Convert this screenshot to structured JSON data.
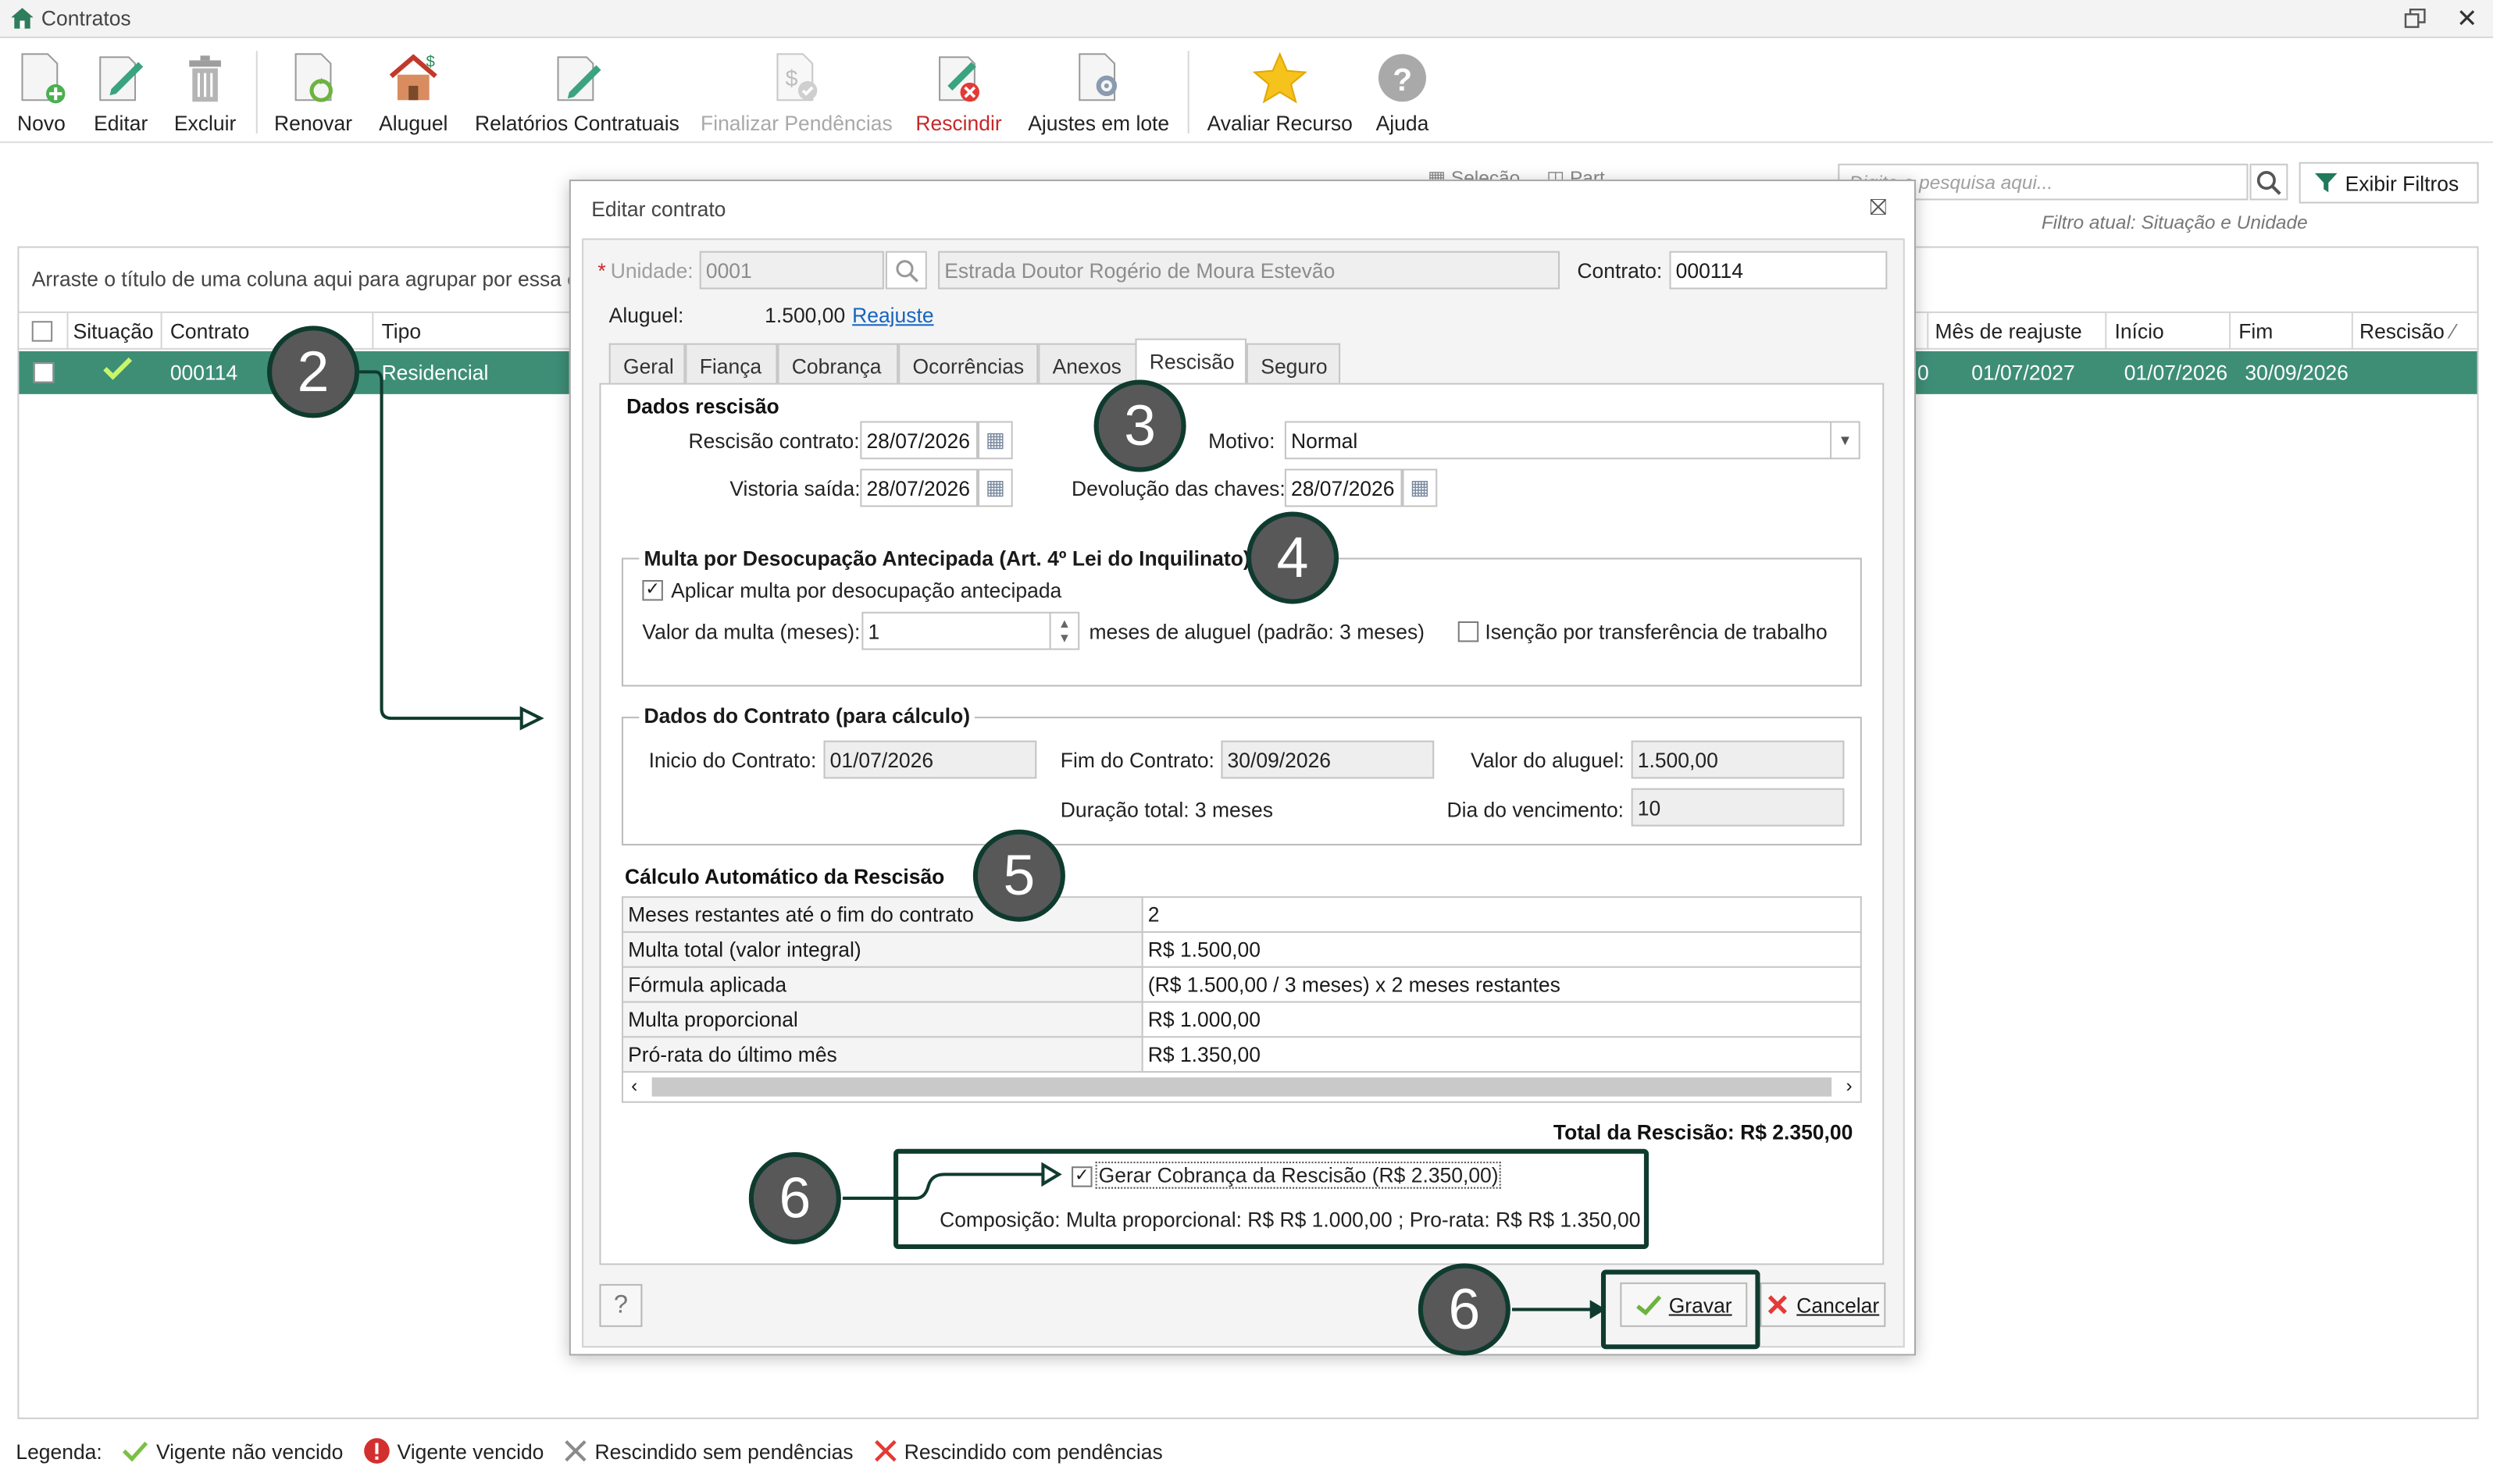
{
  "window": {
    "title": "Contratos"
  },
  "toolbar": {
    "novo": "Novo",
    "editar": "Editar",
    "excluir": "Excluir",
    "renovar": "Renovar",
    "aluguel": "Aluguel",
    "relatorios": "Relatórios Contratuais",
    "finalizar": "Finalizar Pendências",
    "rescindir": "Rescindir",
    "ajustes": "Ajustes em lote",
    "avaliar": "Avaliar Recurso",
    "ajuda": "Ajuda"
  },
  "search": {
    "placeholder": "Digite a pesquisa aqui...",
    "filter_button": "Exibir Filtros",
    "current_filter": "Filtro atual: Situação e Unidade"
  },
  "grid": {
    "group_hint": "Arraste o título de uma coluna aqui para agrupar por essa c",
    "columns": {
      "situacao": "Situação",
      "contrato": "Contrato",
      "tipo": "Tipo",
      "mes_reajuste": "Mês de reajuste",
      "inicio": "Início",
      "fim": "Fim",
      "rescisao": "Rescisão"
    },
    "row": {
      "contrato": "000114",
      "tipo": "Residencial",
      "cut_value": "0",
      "mes_reajuste": "01/07/2027",
      "inicio": "01/07/2026",
      "fim": "30/09/2026"
    }
  },
  "legend": {
    "label": "Legenda:",
    "vigente_nao_vencido": "Vigente não vencido",
    "vigente_vencido": "Vigente vencido",
    "rescindido_sem": "Rescindido sem pendências",
    "rescindido_com": "Rescindido com pendências"
  },
  "dialog": {
    "title": "Editar contrato",
    "unidade_label": "Unidade:",
    "unidade_required": "*",
    "unidade_code": "0001",
    "unidade_name": "Estrada Doutor Rogério de Moura Estevão",
    "contrato_label": "Contrato:",
    "contrato_value": "000114",
    "aluguel_label": "Aluguel:",
    "aluguel_value": "1.500,00",
    "reajuste_link": "Reajuste",
    "tabs": [
      "Geral",
      "Fiança",
      "Cobrança",
      "Ocorrências",
      "Anexos",
      "Rescisão",
      "Seguro"
    ],
    "dados_rescisao": {
      "title": "Dados rescisão",
      "rescisao_label": "Rescisão contrato:",
      "rescisao_value": "28/07/2026",
      "vistoria_label": "Vistoria saída:",
      "vistoria_value": "28/07/2026",
      "motivo_label": "Motivo:",
      "motivo_value": "Normal",
      "devolucao_label": "Devolução das chaves:",
      "devolucao_value": "28/07/2026"
    },
    "multa": {
      "title": "Multa por Desocupação Antecipada (Art. 4º Lei do Inquilinato)",
      "aplicar_label": "Aplicar multa por desocupação antecipada",
      "valor_label": "Valor da multa (meses):",
      "valor_value": "1",
      "meses_hint": "meses de aluguel (padrão: 3 meses)",
      "isencao_label": "Isenção por transferência de trabalho"
    },
    "dados_contrato": {
      "title": "Dados do Contrato (para cálculo)",
      "inicio_label": "Inicio do Contrato:",
      "inicio_value": "01/07/2026",
      "fim_label": "Fim do Contrato:",
      "fim_value": "30/09/2026",
      "valor_label": "Valor do aluguel:",
      "valor_value": "1.500,00",
      "duracao_text": "Duração total: 3 meses",
      "dia_label": "Dia do vencimento:",
      "dia_value": "10"
    },
    "calculo": {
      "title": "Cálculo Automático da Rescisão",
      "rows": [
        {
          "k": "Meses restantes até o fim do contrato",
          "v": "2"
        },
        {
          "k": "Multa total (valor integral)",
          "v": "R$ 1.500,00"
        },
        {
          "k": "Fórmula aplicada",
          "v": "(R$ 1.500,00 / 3 meses) x 2 meses restantes"
        },
        {
          "k": "Multa proporcional",
          "v": "R$ 1.000,00"
        },
        {
          "k": "Pró-rata do último mês",
          "v": "R$ 1.350,00"
        }
      ],
      "total": "Total da Rescisão: R$ 2.350,00"
    },
    "cobranca": {
      "gerar_label": "Gerar Cobrança da Rescisão (R$ 2.350,00)",
      "composicao": "Composição: Multa proporcional: R$ R$ 1.000,00 ; Pro-rata: R$ R$ 1.350,00"
    },
    "help": "?",
    "gravar": "Gravar",
    "cancelar": "Cancelar"
  },
  "callouts": {
    "c2": "2",
    "c3": "3",
    "c4": "4",
    "c5": "5",
    "c6a": "6",
    "c6b": "6"
  },
  "colors": {
    "accent_green": "#3e8e76",
    "callout_fill": "#585858",
    "callout_border": "#0f3b2f",
    "danger": "#c62828"
  }
}
